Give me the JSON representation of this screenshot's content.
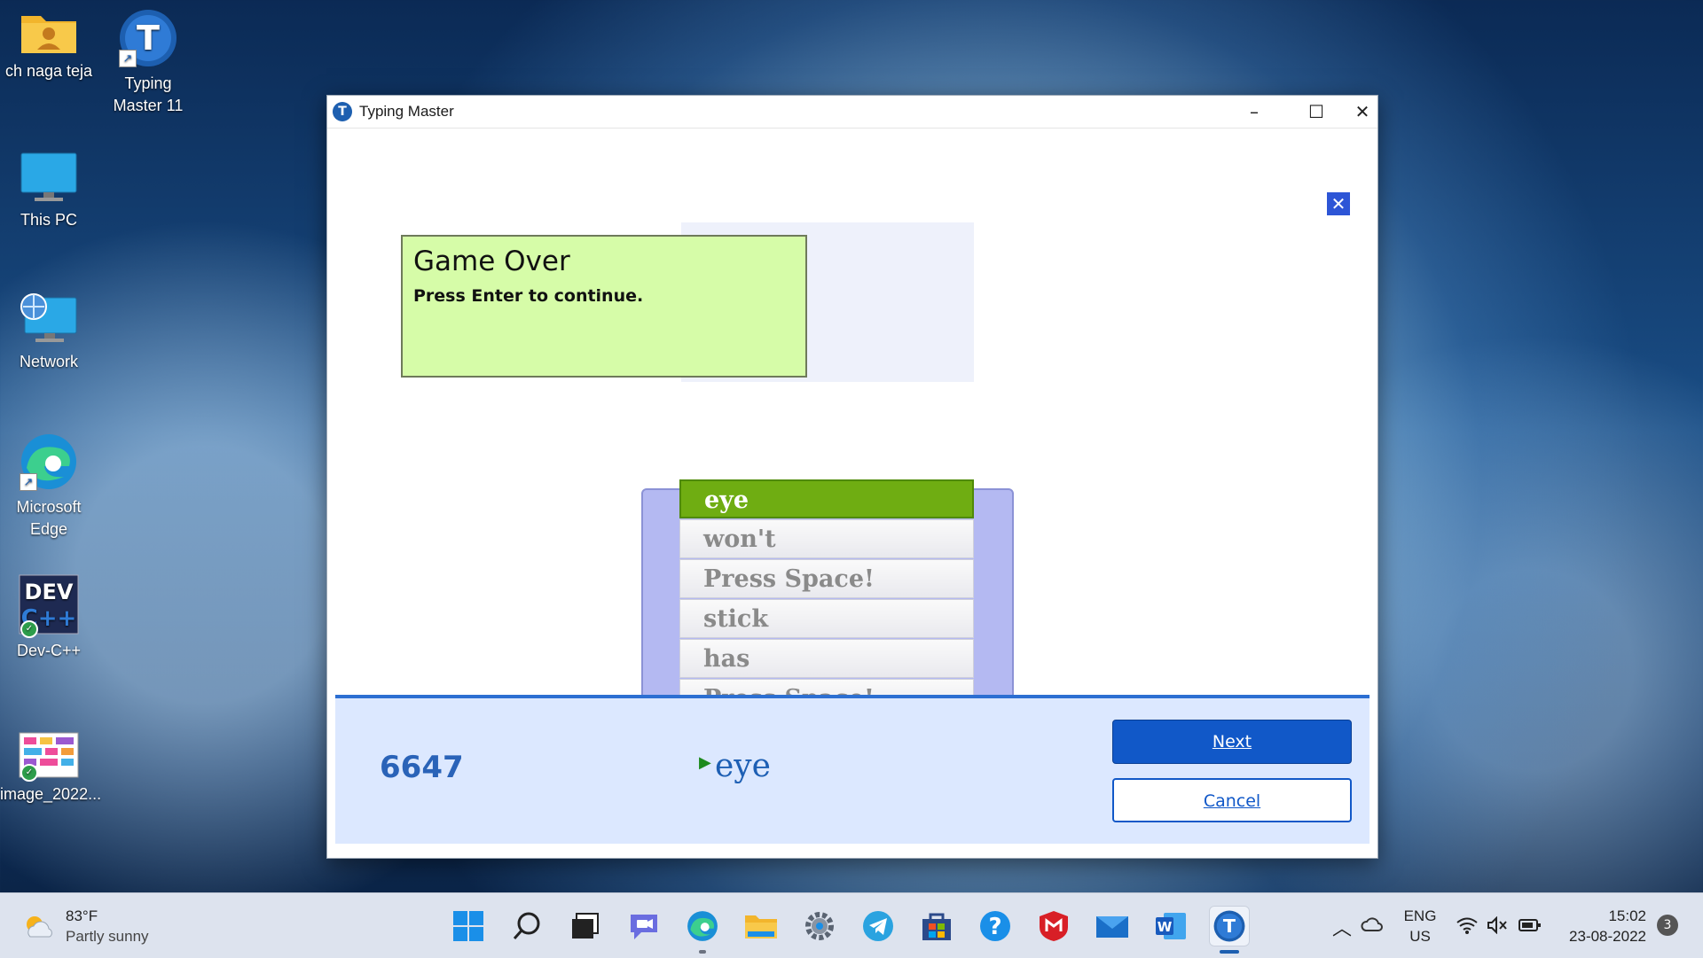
{
  "desktop": {
    "icons": [
      {
        "label": "ch naga teja",
        "icon": "user-folder-icon"
      },
      {
        "label": "Typing Master 11",
        "icon": "typing-master-icon"
      },
      {
        "label": "This PC",
        "icon": "monitor-icon"
      },
      {
        "label": "Network",
        "icon": "network-icon"
      },
      {
        "label": "Microsoft Edge",
        "icon": "edge-icon"
      },
      {
        "label": "Dev-C++",
        "icon": "devcpp-icon"
      },
      {
        "label": "image_2022...",
        "icon": "image-file-icon"
      }
    ]
  },
  "window": {
    "title": "Typing Master",
    "logo_letter": "T",
    "controls": {
      "minimize": "–",
      "maximize": "☐",
      "close": "✕"
    }
  },
  "game": {
    "close_glyph": "✕",
    "overlay": {
      "heading": "Game Over",
      "message": "Press Enter to continue."
    },
    "words": [
      "eye",
      "won't",
      "Press Space!",
      "stick",
      "has",
      "Press Space!"
    ],
    "active_index": 0
  },
  "footer": {
    "score": "6647",
    "current_word": "eye",
    "next_label": "Next",
    "cancel_label": "Cancel"
  },
  "taskbar": {
    "weather": {
      "temp": "83°F",
      "desc": "Partly sunny"
    },
    "apps": [
      "start-icon",
      "search-icon",
      "task-view-icon",
      "chat-icon",
      "edge-icon",
      "file-explorer-icon",
      "settings-icon",
      "telegram-icon",
      "store-icon",
      "help-icon",
      "mcafee-icon",
      "mail-icon",
      "word-icon",
      "typing-master-icon"
    ],
    "tray": {
      "lang": "ENG",
      "region": "US",
      "time": "15:02",
      "date": "23-08-2022",
      "notifications": "3"
    }
  }
}
